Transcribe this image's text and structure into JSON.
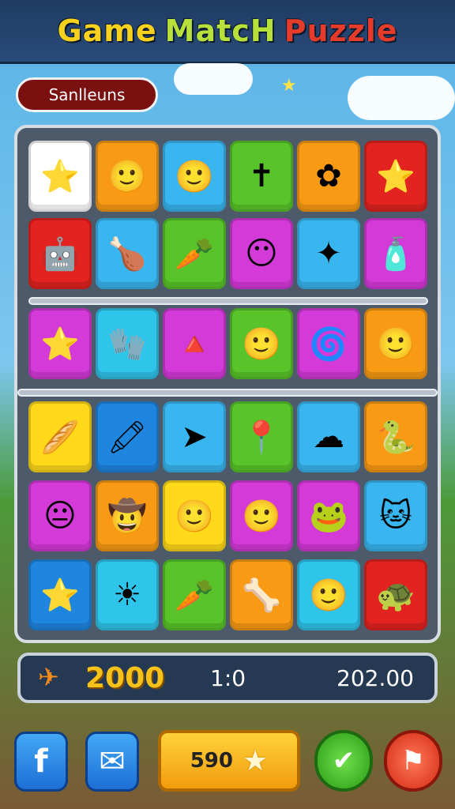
{
  "title": {
    "part1": "Game",
    "part2": "MatcH",
    "part3": "Puzzle"
  },
  "player_name": "Sanlleuns",
  "status": {
    "score": "2000",
    "moves": "1:0",
    "time": "202.00"
  },
  "center_button_value": "590",
  "icons": {
    "sparkle": "★",
    "score_icon": "✈",
    "facebook": "f",
    "mail": "✉",
    "star": "★",
    "check": "✔",
    "hint": "⚑"
  },
  "colors": {
    "yellow": "#ffd91a",
    "orange": "#f89a14",
    "blue": "#39b6f0",
    "green": "#58c42a",
    "red": "#e2231f",
    "magenta": "#d43ad8",
    "white": "#ffffff",
    "cyan": "#2fc4ea"
  },
  "grid": [
    [
      {
        "bg": "#ffffff",
        "icon": "⭐"
      },
      {
        "bg": "#f89a14",
        "icon": "🙂"
      },
      {
        "bg": "#39b6f0",
        "icon": "🙂"
      },
      {
        "bg": "#58c42a",
        "icon": "✝"
      },
      {
        "bg": "#f89a14",
        "icon": "✿"
      },
      {
        "bg": "#e2231f",
        "icon": "⭐"
      }
    ],
    [
      {
        "bg": "#e2231f",
        "icon": "🤖"
      },
      {
        "bg": "#39b6f0",
        "icon": "🍗"
      },
      {
        "bg": "#58c42a",
        "icon": "🥕"
      },
      {
        "bg": "#d43ad8",
        "icon": "😶"
      },
      {
        "bg": "#39b6f0",
        "icon": "✦"
      },
      {
        "bg": "#d43ad8",
        "icon": "🧴"
      }
    ],
    [
      {
        "bg": "#d43ad8",
        "icon": "⭐"
      },
      {
        "bg": "#2fc4ea",
        "icon": "🧤"
      },
      {
        "bg": "#d43ad8",
        "icon": "🔺"
      },
      {
        "bg": "#58c42a",
        "icon": "🙂"
      },
      {
        "bg": "#d43ad8",
        "icon": "🌀"
      },
      {
        "bg": "#f89a14",
        "icon": "🙂"
      }
    ],
    [
      {
        "bg": "#ffd91a",
        "icon": "🥖"
      },
      {
        "bg": "#1f86e0",
        "icon": "🖍"
      },
      {
        "bg": "#39b6f0",
        "icon": "➤"
      },
      {
        "bg": "#58c42a",
        "icon": "📍"
      },
      {
        "bg": "#39b6f0",
        "icon": "☁"
      },
      {
        "bg": "#f89a14",
        "icon": "🐍"
      }
    ],
    [
      {
        "bg": "#d43ad8",
        "icon": "😐"
      },
      {
        "bg": "#f89a14",
        "icon": "🤠"
      },
      {
        "bg": "#ffd91a",
        "icon": "🙂"
      },
      {
        "bg": "#d43ad8",
        "icon": "🙂"
      },
      {
        "bg": "#d43ad8",
        "icon": "🐸"
      },
      {
        "bg": "#39b6f0",
        "icon": "🐱"
      }
    ],
    [
      {
        "bg": "#1f86e0",
        "icon": "⭐"
      },
      {
        "bg": "#2fc4ea",
        "icon": "☀"
      },
      {
        "bg": "#58c42a",
        "icon": "🥕"
      },
      {
        "bg": "#f89a14",
        "icon": "🦴"
      },
      {
        "bg": "#2fc4ea",
        "icon": "🙂"
      },
      {
        "bg": "#e2231f",
        "icon": "🐢"
      }
    ]
  ]
}
